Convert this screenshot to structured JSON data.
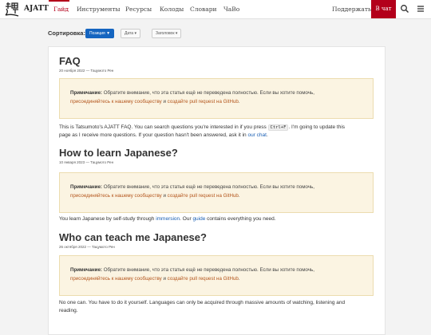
{
  "nav": {
    "brand": "AJATT",
    "items": [
      "Гайд",
      "Инструменты",
      "Ресурсы",
      "Колоды",
      "Словари",
      "ЧаВо"
    ],
    "support": "Поддержать",
    "chat": "В чат",
    "accent": "#b3001b"
  },
  "sort": {
    "label": "Сортировка:",
    "options": [
      "Позиция",
      "Дата",
      "Заголовок"
    ]
  },
  "note": {
    "label": "Примечание:",
    "text1": " Обратите внимание, что эта статья ещё не переведена полностью. Если вы хотите помочь,",
    "link1": "присоединяйтесь к нашему сообществу",
    "and": " и ",
    "link2": "создайте pull request на GitHub",
    "end": "."
  },
  "sections": [
    {
      "title": "FAQ",
      "meta": "20 ноября 2022 — Тацумото Рен",
      "p1a": "This is Tatsumoto's AJATT FAQ. You can search questions you're interested in if you press ",
      "p1code": "Ctrl+F",
      "p1b": ". I'm going to update this",
      "p2a": "page as I receive more questions. If your question hasn't been answered, ask it in ",
      "p2link": "our chat",
      "p2b": "."
    },
    {
      "title": "How to learn Japanese?",
      "meta": "10 января 2023 — Тацумото Рен",
      "pa": "You learn Japanese by self-study through ",
      "plink1": "immersion",
      "pb": ". Our ",
      "plink2": "guide",
      "pc": " contains everything you need."
    },
    {
      "title": "Who can teach me Japanese?",
      "meta": "26 октября 2022 — Тацумото Рен",
      "p1": "No one can. You have to do it yourself. Languages can only be acquired through massive amounts of watching, listening and",
      "p2": "reading."
    }
  ]
}
